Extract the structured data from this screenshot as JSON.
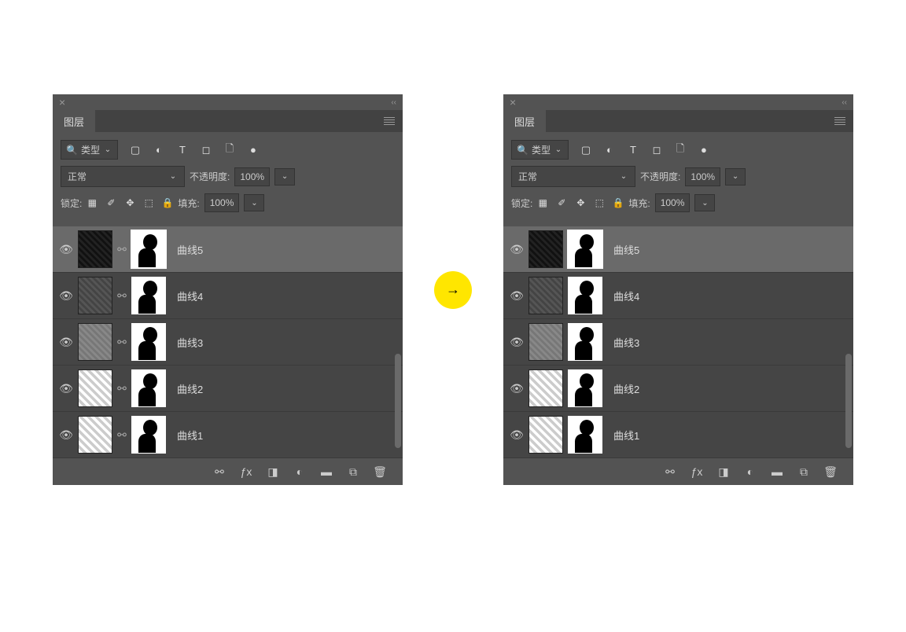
{
  "panel_title": "图层",
  "filter_label": "类型",
  "blend_mode": "正常",
  "opacity_label": "不透明度:",
  "opacity_value": "100%",
  "lock_label": "锁定:",
  "fill_label": "填充:",
  "fill_value": "100%",
  "left_panel": {
    "show_link": true,
    "layers": [
      {
        "name": "曲线5",
        "thumb": "t1",
        "selected": true
      },
      {
        "name": "曲线4",
        "thumb": "t2",
        "selected": false
      },
      {
        "name": "曲线3",
        "thumb": "t3",
        "selected": false
      },
      {
        "name": "曲线2",
        "thumb": "t4",
        "selected": false
      },
      {
        "name": "曲线1",
        "thumb": "t5",
        "selected": false
      }
    ]
  },
  "right_panel": {
    "show_link": false,
    "layers": [
      {
        "name": "曲线5",
        "thumb": "t1",
        "selected": true
      },
      {
        "name": "曲线4",
        "thumb": "t2",
        "selected": false
      },
      {
        "name": "曲线3",
        "thumb": "t3",
        "selected": false
      },
      {
        "name": "曲线2",
        "thumb": "t4",
        "selected": false
      },
      {
        "name": "曲线1",
        "thumb": "t5",
        "selected": false
      }
    ]
  },
  "filter_icons": [
    "image-icon",
    "adjustment-icon",
    "type-icon",
    "shape-icon",
    "smartobject-icon",
    "artboard-icon"
  ],
  "lock_icons": [
    "transparency-icon",
    "brush-icon",
    "move-icon",
    "artboard-lock-icon",
    "lock-all-icon"
  ],
  "footer_icons": [
    "link-icon",
    "fx-icon",
    "mask-icon",
    "adjustment-layer-icon",
    "group-icon",
    "new-layer-icon",
    "trash-icon"
  ]
}
